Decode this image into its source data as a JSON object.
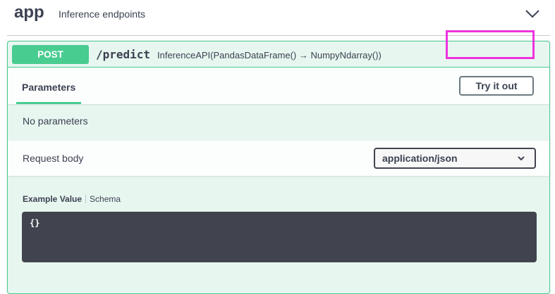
{
  "tag": {
    "name": "app",
    "description": "Inference endpoints"
  },
  "operation": {
    "method": "POST",
    "path": "/predict",
    "summary": "InferenceAPI(PandasDataFrame() → NumpyNdarray())",
    "parameters_tab": "Parameters",
    "try_button": "Try it out",
    "no_parameters": "No parameters",
    "request_body_label": "Request body",
    "content_type": "application/json",
    "example_value_tab": "Example Value",
    "schema_tab": "Schema",
    "example_code": "{}"
  },
  "colors": {
    "post_green": "#49cc90",
    "highlight": "#ee33dd",
    "code_bg": "#41444e"
  }
}
